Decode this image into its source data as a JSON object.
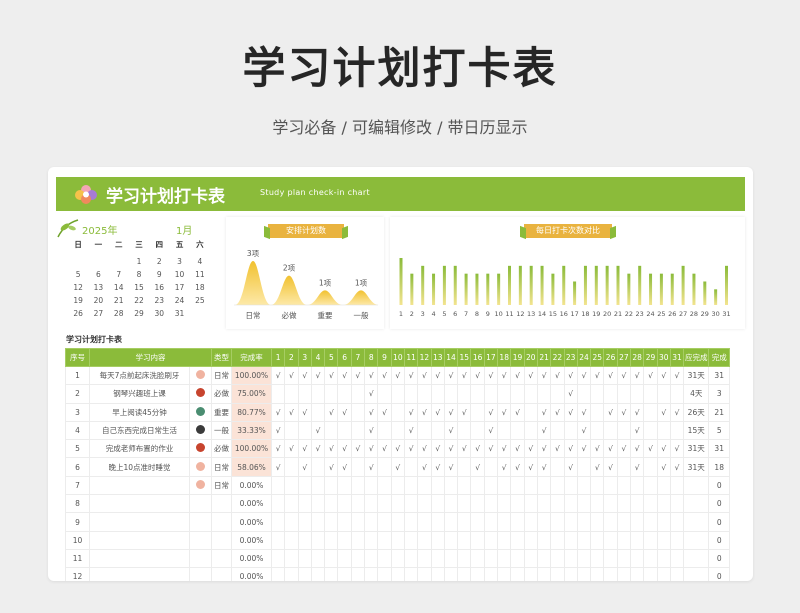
{
  "hero": {
    "title": "学习计划打卡表",
    "subtitle": "学习必备 /  可编辑修改  / 带日历显示"
  },
  "banner": {
    "title": "学习计划打卡表",
    "subtitle": "Study plan check-in chart"
  },
  "calendar": {
    "year": "2025年",
    "month": "1月",
    "weekdays": [
      "日",
      "一",
      "二",
      "三",
      "四",
      "五",
      "六"
    ],
    "days": [
      "",
      "",
      "",
      "1",
      "2",
      "3",
      "4",
      "5",
      "6",
      "7",
      "8",
      "9",
      "10",
      "11",
      "12",
      "13",
      "14",
      "15",
      "16",
      "17",
      "18",
      "19",
      "20",
      "21",
      "22",
      "23",
      "24",
      "25",
      "26",
      "27",
      "28",
      "29",
      "30",
      "31",
      "",
      ""
    ]
  },
  "arrange_chart": {
    "ribbon": "安排计划数"
  },
  "daily_chart": {
    "ribbon": "每日打卡次数对比"
  },
  "chart_data": [
    {
      "type": "area",
      "categories": [
        "日常",
        "必做",
        "重要",
        "一般"
      ],
      "values": [
        3,
        2,
        1,
        1
      ],
      "data_labels": [
        "3项",
        "2项",
        "1项",
        "1项"
      ],
      "colors": {
        "fill": "#f1c12f",
        "fill_fade": "#fde9a8"
      }
    },
    {
      "type": "bar",
      "categories": [
        "1",
        "2",
        "3",
        "4",
        "5",
        "6",
        "7",
        "8",
        "9",
        "10",
        "11",
        "12",
        "13",
        "14",
        "15",
        "16",
        "17",
        "18",
        "19",
        "20",
        "21",
        "22",
        "23",
        "24",
        "25",
        "26",
        "27",
        "28",
        "29",
        "30",
        "31"
      ],
      "values": [
        6,
        4,
        5,
        4,
        5,
        5,
        4,
        4,
        4,
        4,
        5,
        5,
        5,
        5,
        4,
        5,
        3,
        5,
        5,
        5,
        5,
        4,
        5,
        4,
        4,
        4,
        5,
        4,
        3,
        2,
        5
      ],
      "colors": {
        "top": "#8bbb3a",
        "bottom": "#f3e48f"
      }
    }
  ],
  "section_title": "学习计划打卡表",
  "table": {
    "headers": {
      "idx": "序号",
      "content": "学习内容",
      "type": "类型",
      "rate": "完成率",
      "days": [
        "1",
        "2",
        "3",
        "4",
        "5",
        "6",
        "7",
        "8",
        "9",
        "10",
        "11",
        "12",
        "13",
        "14",
        "15",
        "16",
        "17",
        "18",
        "19",
        "20",
        "21",
        "22",
        "23",
        "24",
        "25",
        "26",
        "27",
        "28",
        "29",
        "30",
        "31"
      ],
      "done_days": "应完成",
      "done": "完成"
    },
    "mark": "√",
    "rows": [
      {
        "idx": "1",
        "content": "每天7点前起床洗脸刷牙",
        "dot": "#f0b3a0",
        "type": "日常",
        "rate": "100.00%",
        "checks": "1111111111111111111111111111111",
        "due": "31天",
        "done": "31"
      },
      {
        "idx": "2",
        "content": "钢琴兴趣班上课",
        "dot": "#c7442e",
        "type": "必做",
        "rate": "75.00%",
        "checks": "0000000100000000000000100000000",
        "due": "4天",
        "done": "3"
      },
      {
        "idx": "3",
        "content": "早上阅读45分钟",
        "dot": "#4a8d71",
        "type": "重要",
        "rate": "80.77%",
        "checks": "1110110110111110111011110111011",
        "due": "26天",
        "done": "21"
      },
      {
        "idx": "4",
        "content": "自己东西完成日常生活",
        "dot": "#3b3b3b",
        "type": "一般",
        "rate": "33.33%",
        "checks": "1001000100100100100010010001000",
        "due": "15天",
        "done": "5"
      },
      {
        "idx": "5",
        "content": "完成老师布置的作业",
        "dot": "#c7442e",
        "type": "必做",
        "rate": "100.00%",
        "checks": "1111111111111111111111111111111",
        "due": "31天",
        "done": "31"
      },
      {
        "idx": "6",
        "content": "晚上10点准时睡觉",
        "dot": "#f0b3a0",
        "type": "日常",
        "rate": "58.06%",
        "checks": "1010110101011101011110101101011",
        "due": "31天",
        "done": "18"
      },
      {
        "idx": "7",
        "content": "",
        "dot": "#f0b3a0",
        "type": "日常",
        "rate": "0.00%",
        "checks": "",
        "due": "",
        "done": "0"
      },
      {
        "idx": "8",
        "content": "",
        "dot": "",
        "type": "",
        "rate": "0.00%",
        "checks": "",
        "due": "",
        "done": "0"
      },
      {
        "idx": "9",
        "content": "",
        "dot": "",
        "type": "",
        "rate": "0.00%",
        "checks": "",
        "due": "",
        "done": "0"
      },
      {
        "idx": "10",
        "content": "",
        "dot": "",
        "type": "",
        "rate": "0.00%",
        "checks": "",
        "due": "",
        "done": "0"
      },
      {
        "idx": "11",
        "content": "",
        "dot": "",
        "type": "",
        "rate": "0.00%",
        "checks": "",
        "due": "",
        "done": "0"
      },
      {
        "idx": "12",
        "content": "",
        "dot": "",
        "type": "",
        "rate": "0.00%",
        "checks": "",
        "due": "",
        "done": "0"
      }
    ]
  }
}
